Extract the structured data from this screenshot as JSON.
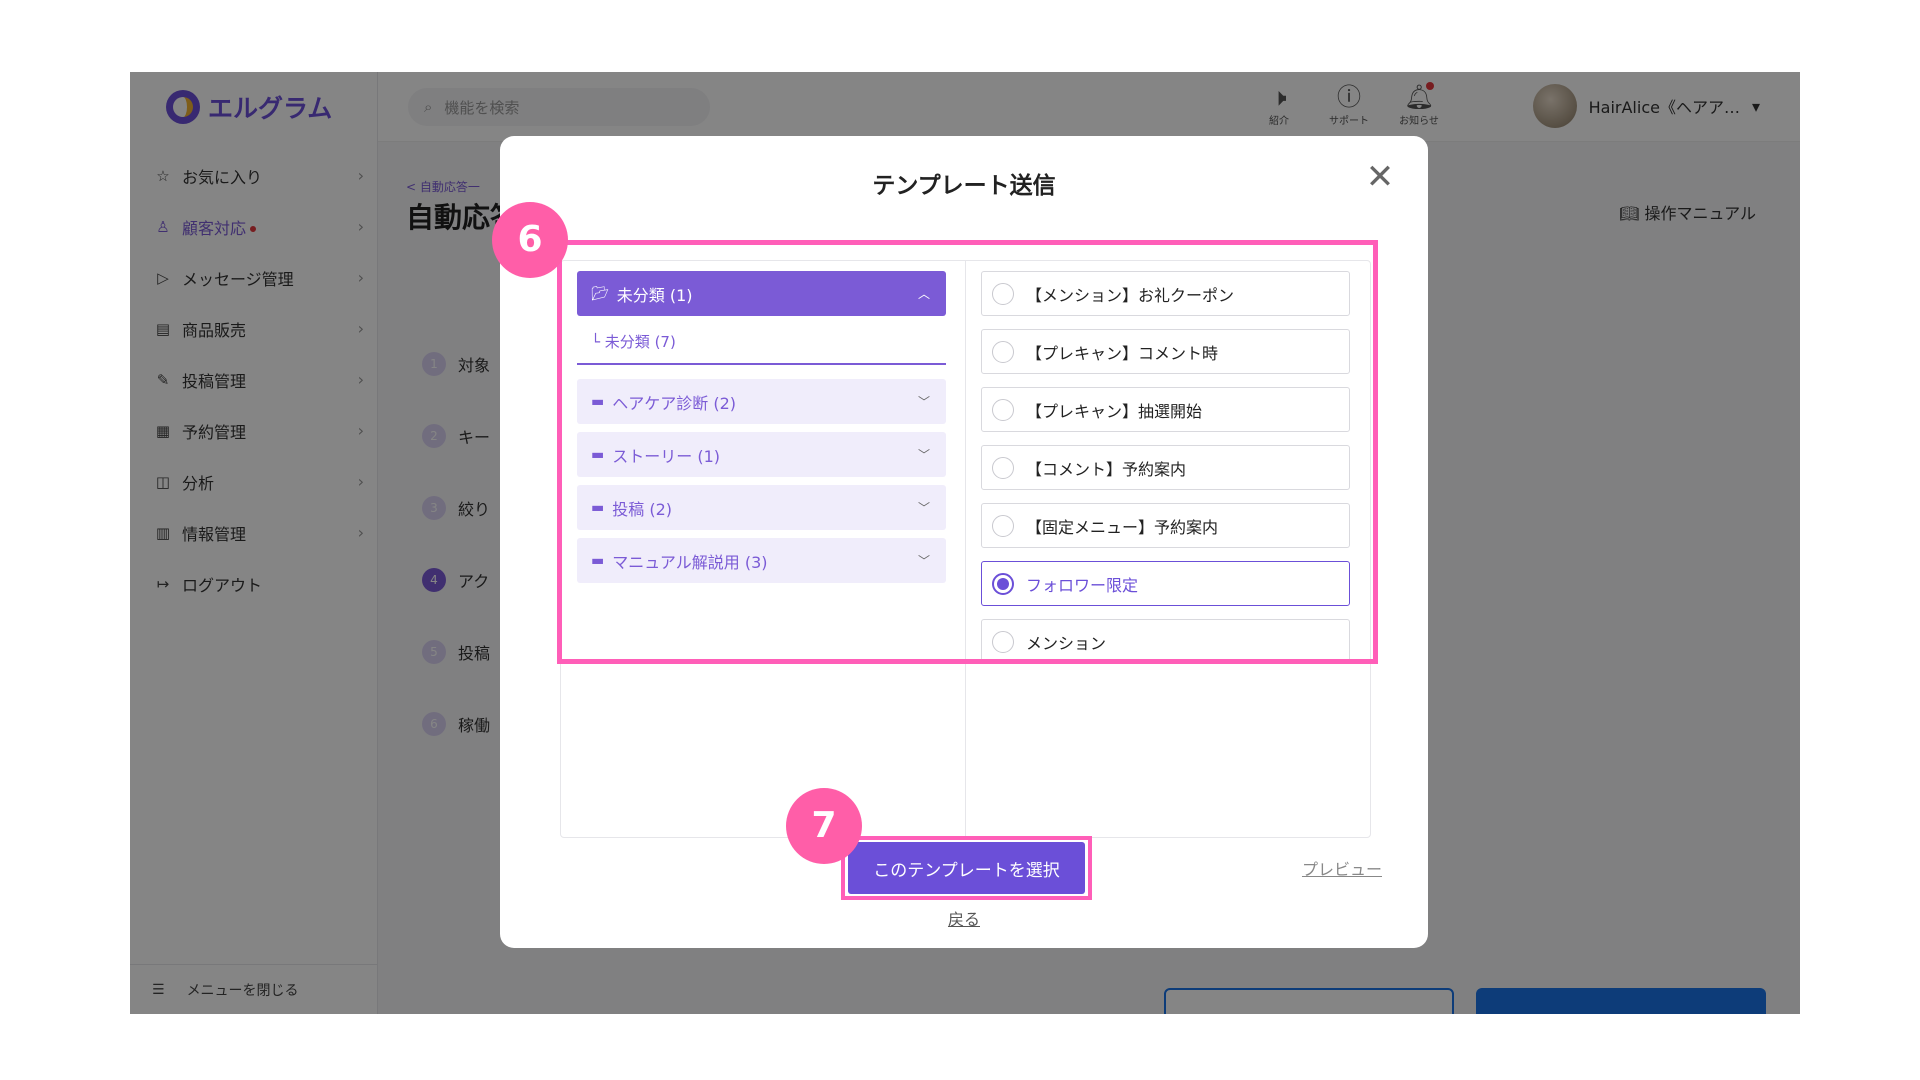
{
  "app": {
    "logo_text": "エルグラム",
    "search_placeholder": "機能を検索",
    "topbar_icons": [
      {
        "icon": "speaker-icon",
        "label": "紹介"
      },
      {
        "icon": "help-circle-icon",
        "label": "サポート"
      },
      {
        "icon": "bell-icon",
        "label": "お知らせ"
      }
    ],
    "user_name": "HairAlice《ヘアア…",
    "sidebar": {
      "items": [
        {
          "label": "お気に入り",
          "icon": "star-icon"
        },
        {
          "label": "顧客対応",
          "icon": "person-icon"
        },
        {
          "label": "メッセージ管理",
          "icon": "send-icon"
        },
        {
          "label": "商品販売",
          "icon": "store-icon"
        },
        {
          "label": "投稿管理",
          "icon": "edit-icon"
        },
        {
          "label": "予約管理",
          "icon": "calendar-icon"
        },
        {
          "label": "分析",
          "icon": "analytics-icon"
        },
        {
          "label": "情報管理",
          "icon": "bar-chart-icon"
        },
        {
          "label": "ログアウト",
          "icon": "logout-icon"
        }
      ],
      "footer_label": "メニューを閉じる"
    },
    "main": {
      "breadcrumb": "< 自動応答一",
      "page_title": "自動応答",
      "manual_label": "操作マニュアル",
      "steps": [
        {
          "num": "1",
          "label": "対象"
        },
        {
          "num": "2",
          "label": "キー"
        },
        {
          "num": "3",
          "label": "絞り"
        },
        {
          "num": "4",
          "label": "アク"
        },
        {
          "num": "5",
          "label": "投稿"
        },
        {
          "num": "6",
          "label": "稼働"
        }
      ]
    }
  },
  "modal": {
    "title": "テンプレート送信",
    "categories": {
      "expanded": {
        "label": "未分類 (1)",
        "sub": "└ 未分類 (7)"
      },
      "collapsed": [
        {
          "label": "ヘアケア診断 (2)"
        },
        {
          "label": "ストーリー (1)"
        },
        {
          "label": "投稿 (2)"
        },
        {
          "label": "マニュアル解説用 (3)"
        }
      ]
    },
    "templates": [
      {
        "label": "【メンション】お礼クーポン",
        "selected": false
      },
      {
        "label": "【プレキャン】コメント時",
        "selected": false
      },
      {
        "label": "【プレキャン】抽選開始",
        "selected": false
      },
      {
        "label": "【コメント】予約案内",
        "selected": false
      },
      {
        "label": "【固定メニュー】予約案内",
        "selected": false
      },
      {
        "label": "フォロワー限定",
        "selected": true
      },
      {
        "label": "メンション",
        "selected": false
      }
    ],
    "select_button": "このテンプレートを選択",
    "back_link": "戻る",
    "preview_link": "プレビュー"
  },
  "annotations": {
    "badge_list": "6",
    "badge_button": "7"
  },
  "colors": {
    "accent": "#6b4fd8",
    "highlight": "#ff5eb8"
  }
}
